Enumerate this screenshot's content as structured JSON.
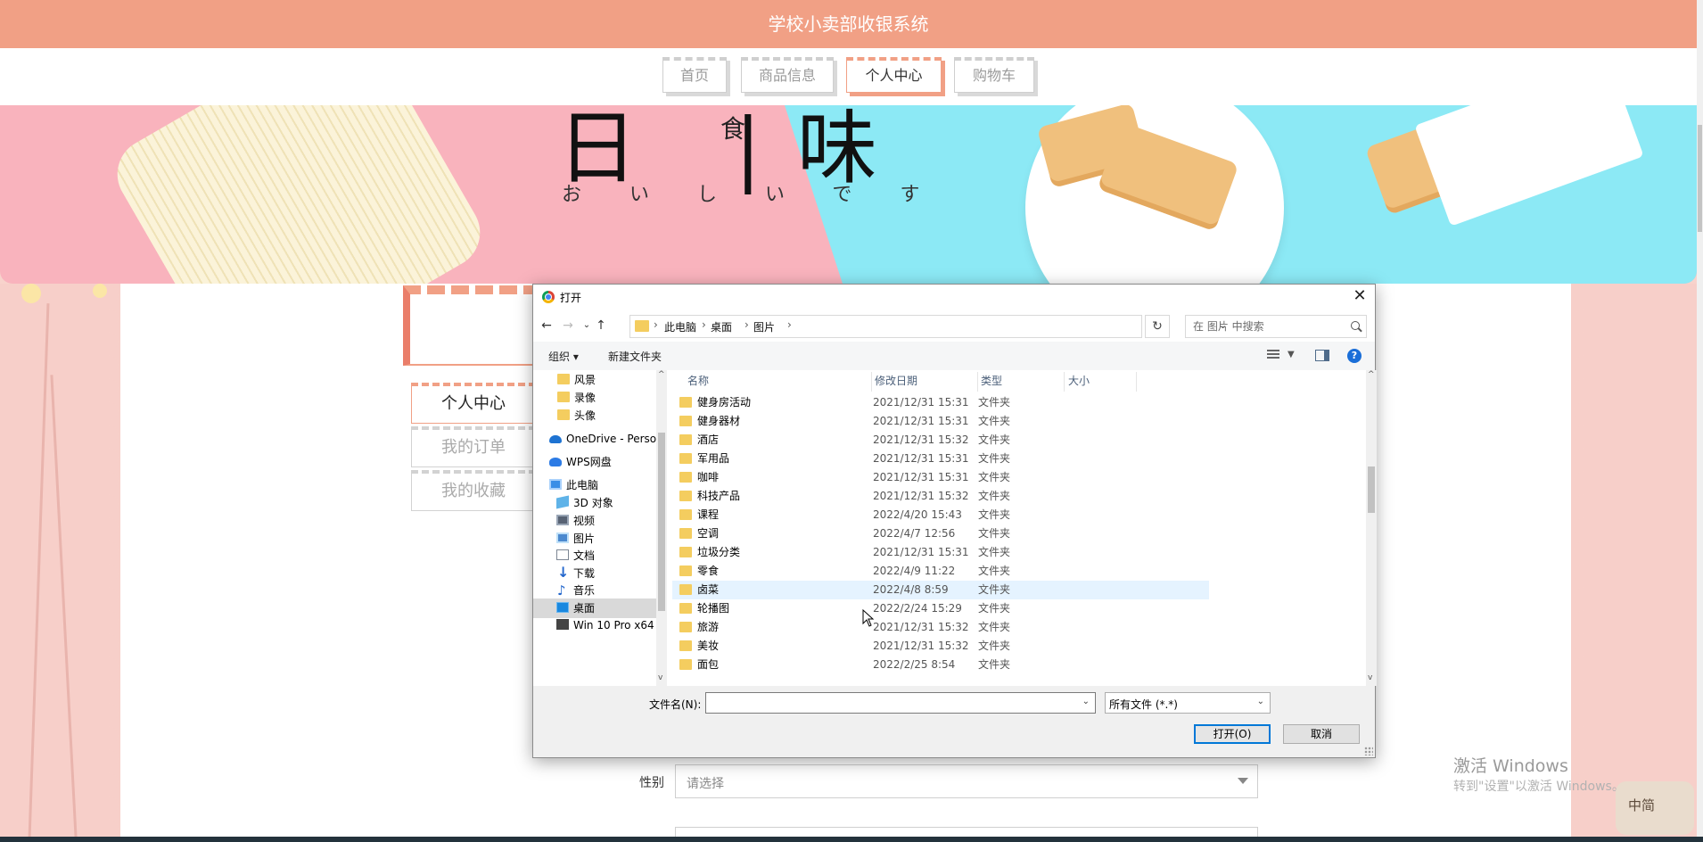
{
  "app": {
    "title": "学校小卖部收银系统"
  },
  "nav": {
    "tabs": [
      {
        "label": "首页",
        "active": false
      },
      {
        "label": "商品信息",
        "active": false
      },
      {
        "label": "个人中心",
        "active": true
      },
      {
        "label": "购物车",
        "active": false
      }
    ]
  },
  "banner": {
    "big_text": "日 |味",
    "small_text": "食",
    "kana": "おいしいです"
  },
  "sidebar": {
    "items": [
      {
        "label": "个人中心",
        "active": true
      },
      {
        "label": "我的订单",
        "active": false
      },
      {
        "label": "我的收藏",
        "active": false
      }
    ]
  },
  "form": {
    "gender_label": "性别",
    "gender_placeholder": "请选择"
  },
  "dialog": {
    "title": "打开",
    "close_glyph": "✕",
    "breadcrumb": [
      "此电脑",
      "桌面",
      "图片"
    ],
    "search_placeholder": "在 图片 中搜索",
    "toolbar": {
      "organize": "组织 ▾",
      "new_folder": "新建文件夹"
    },
    "tree": [
      {
        "label": "风景",
        "icon": "folder-icon"
      },
      {
        "label": "录像",
        "icon": "folder-icon"
      },
      {
        "label": "头像",
        "icon": "folder-icon"
      },
      {
        "label": "OneDrive - Perso",
        "icon": "onedrive-icon"
      },
      {
        "label": "WPS网盘",
        "icon": "wps-cloud-icon"
      },
      {
        "label": "此电脑",
        "icon": "computer-icon"
      },
      {
        "label": "3D 对象",
        "icon": "3d-objects-icon"
      },
      {
        "label": "视频",
        "icon": "video-icon"
      },
      {
        "label": "图片",
        "icon": "pictures-icon"
      },
      {
        "label": "文档",
        "icon": "documents-icon"
      },
      {
        "label": "下载",
        "icon": "download-icon"
      },
      {
        "label": "音乐",
        "icon": "music-icon"
      },
      {
        "label": "桌面",
        "icon": "desktop-icon",
        "selected": true
      },
      {
        "label": "Win 10 Pro x64",
        "icon": "drive-icon"
      }
    ],
    "columns": {
      "name": "名称",
      "date": "修改日期",
      "type": "类型",
      "size": "大小"
    },
    "files": [
      {
        "name": "健身房活动",
        "date": "2021/12/31 15:31",
        "type": "文件夹"
      },
      {
        "name": "健身器材",
        "date": "2021/12/31 15:31",
        "type": "文件夹"
      },
      {
        "name": "酒店",
        "date": "2021/12/31 15:32",
        "type": "文件夹"
      },
      {
        "name": "军用品",
        "date": "2021/12/31 15:31",
        "type": "文件夹"
      },
      {
        "name": "咖啡",
        "date": "2021/12/31 15:31",
        "type": "文件夹"
      },
      {
        "name": "科技产品",
        "date": "2021/12/31 15:32",
        "type": "文件夹"
      },
      {
        "name": "课程",
        "date": "2022/4/20 15:43",
        "type": "文件夹"
      },
      {
        "name": "空调",
        "date": "2022/4/7 12:56",
        "type": "文件夹"
      },
      {
        "name": "垃圾分类",
        "date": "2021/12/31 15:31",
        "type": "文件夹"
      },
      {
        "name": "零食",
        "date": "2022/4/9 11:22",
        "type": "文件夹"
      },
      {
        "name": "卤菜",
        "date": "2022/4/8 8:59",
        "type": "文件夹",
        "hover": true
      },
      {
        "name": "轮播图",
        "date": "2022/2/24 15:29",
        "type": "文件夹"
      },
      {
        "name": "旅游",
        "date": "2021/12/31 15:32",
        "type": "文件夹"
      },
      {
        "name": "美妆",
        "date": "2021/12/31 15:32",
        "type": "文件夹"
      },
      {
        "name": "面包",
        "date": "2022/2/25 8:54",
        "type": "文件夹"
      }
    ],
    "filename_label": "文件名(N):",
    "filename_value": "",
    "filetype_value": "所有文件 (*.*)",
    "open_button": "打开(O)",
    "cancel_button": "取消"
  },
  "watermark": {
    "line1": "激活 Windows",
    "line2": "转到\"设置\"以激活 Windows。"
  },
  "ime": {
    "label": "中简"
  },
  "colors": {
    "accent": "#f1a085",
    "banner_pink": "#f9b3bd",
    "banner_cyan": "#8ce9f5",
    "page_pink": "#f7cfc9",
    "dialog_primary": "#0078d7"
  }
}
